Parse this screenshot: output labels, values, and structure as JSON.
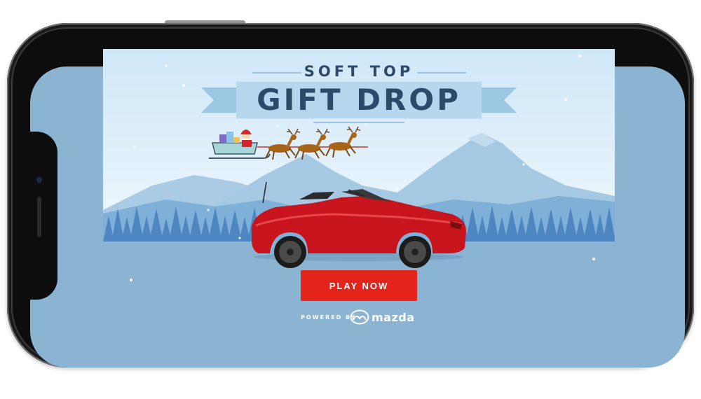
{
  "ad": {
    "title_top": "SOFT TOP",
    "title_main": "GIFT DROP",
    "cta_label": "PLAY NOW",
    "powered_by": "POWERED BY",
    "brand": "mazda"
  },
  "colors": {
    "sky": "#cfe7f7",
    "ground": "#8bb4d2",
    "title": "#2b4a6a",
    "cta": "#e4241b",
    "car": "#c8141c",
    "trees": "#4d86c0"
  },
  "icons": [
    "santa-sleigh-icon",
    "reindeer-icon",
    "snowflake-icon",
    "mazda-logo-icon"
  ]
}
